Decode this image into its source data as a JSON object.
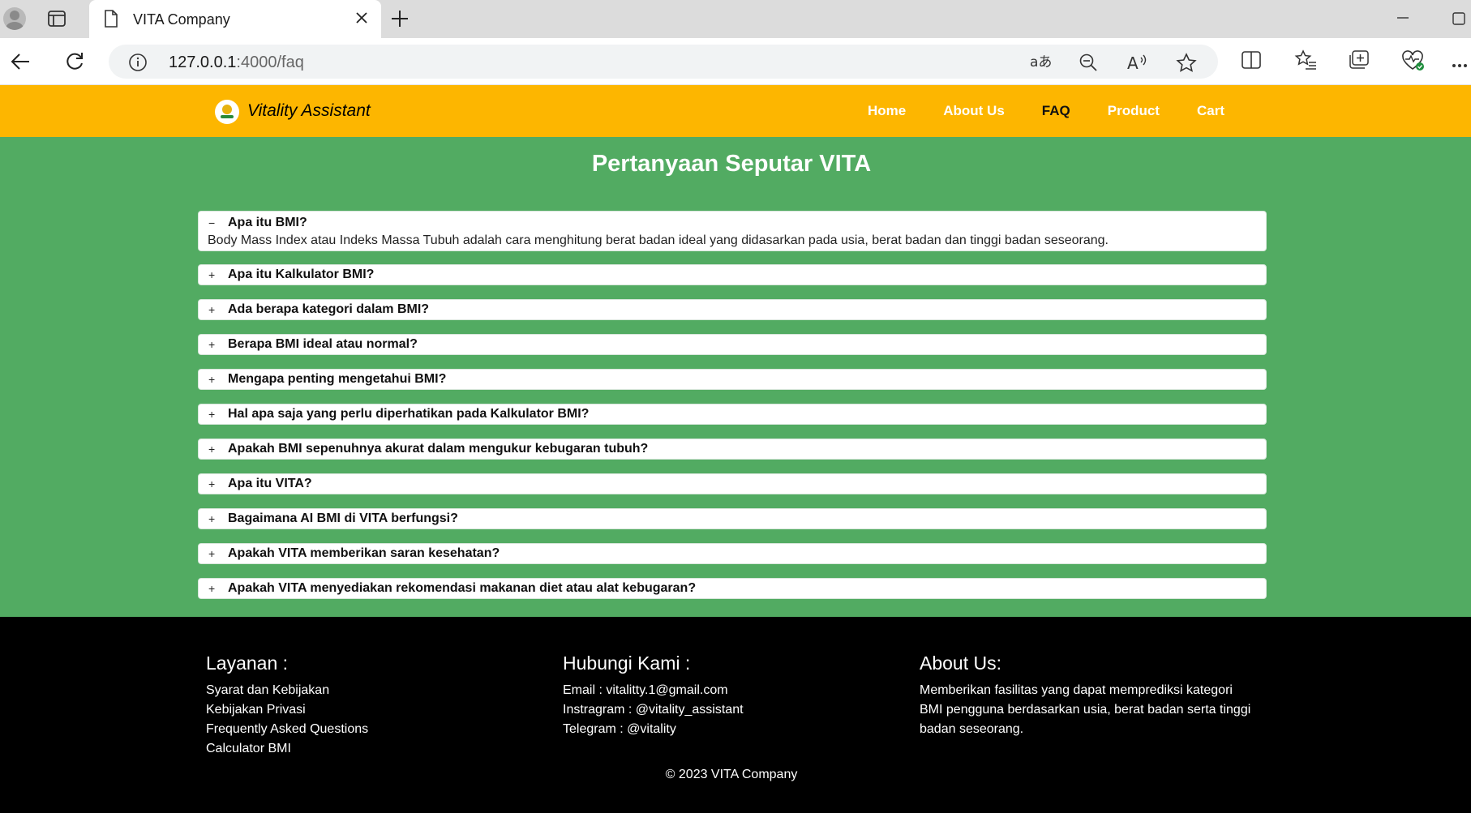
{
  "browser": {
    "tab_title": "VITA Company",
    "url_host": "127.0.0.1",
    "url_path": ":4000/faq"
  },
  "navbar": {
    "brand": "Vitality Assistant",
    "links": [
      {
        "label": "Home"
      },
      {
        "label": "About Us"
      },
      {
        "label": "FAQ"
      },
      {
        "label": "Product"
      },
      {
        "label": "Cart"
      }
    ]
  },
  "faq": {
    "title": "Pertanyaan Seputar VITA",
    "items": [
      {
        "sign": "−",
        "question": "Apa itu BMI?",
        "answer": "Body Mass Index atau Indeks Massa Tubuh adalah cara menghitung berat badan ideal yang didasarkan pada usia, berat badan dan tinggi badan seseorang."
      },
      {
        "sign": "+",
        "question": "Apa itu Kalkulator BMI?"
      },
      {
        "sign": "+",
        "question": "Ada berapa kategori dalam BMI?"
      },
      {
        "sign": "+",
        "question": "Berapa BMI ideal atau normal?"
      },
      {
        "sign": "+",
        "question": "Mengapa penting mengetahui BMI?"
      },
      {
        "sign": "+",
        "question": "Hal apa saja yang perlu diperhatikan pada Kalkulator BMI?"
      },
      {
        "sign": "+",
        "question": "Apakah BMI sepenuhnya akurat dalam mengukur kebugaran tubuh?"
      },
      {
        "sign": "+",
        "question": "Apa itu VITA?"
      },
      {
        "sign": "+",
        "question": "Bagaimana AI BMI di VITA berfungsi?"
      },
      {
        "sign": "+",
        "question": "Apakah VITA memberikan saran kesehatan?"
      },
      {
        "sign": "+",
        "question": "Apakah VITA menyediakan rekomendasi makanan diet atau alat kebugaran?"
      }
    ]
  },
  "footer": {
    "layanan": {
      "title": "Layanan :",
      "items": [
        "Syarat dan Kebijakan",
        "Kebijakan Privasi",
        "Frequently Asked Questions",
        "Calculator BMI"
      ]
    },
    "hubungi": {
      "title": "Hubungi Kami :",
      "items": [
        "Email : vitalitty.1@gmail.com",
        "Instragram : @vitality_assistant",
        "Telegram : @vitality"
      ]
    },
    "about": {
      "title": "About Us:",
      "lines": [
        "Memberikan fasilitas yang dapat memprediksi kategori",
        "BMI pengguna berdasarkan usia, berat badan serta tinggi",
        "badan seseorang."
      ]
    },
    "copyright": "© 2023 VITA Company"
  }
}
